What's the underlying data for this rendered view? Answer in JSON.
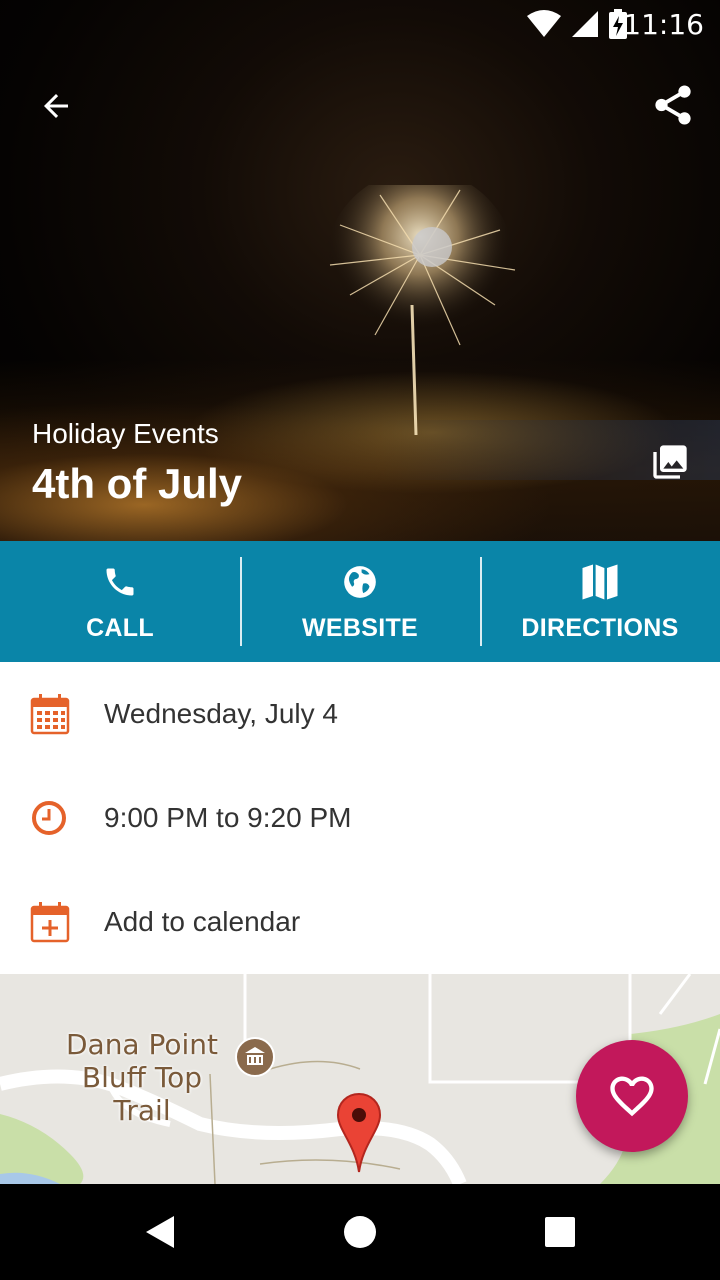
{
  "status_bar": {
    "time": "11:16"
  },
  "hero": {
    "category": "Holiday Events",
    "title": "4th of July"
  },
  "actions": [
    {
      "label": "CALL",
      "icon": "phone-icon"
    },
    {
      "label": "WEBSITE",
      "icon": "globe-icon"
    },
    {
      "label": "DIRECTIONS",
      "icon": "map-icon"
    }
  ],
  "details": {
    "date": "Wednesday, July 4",
    "time": "9:00 PM to 9:20 PM",
    "add_calendar": "Add to calendar"
  },
  "map": {
    "place_line1": "Dana Point",
    "place_line2": "Bluff Top Trail"
  },
  "colors": {
    "accent_bar": "#0a85a8",
    "icon_orange": "#e5622a",
    "fab": "#c2185b"
  }
}
